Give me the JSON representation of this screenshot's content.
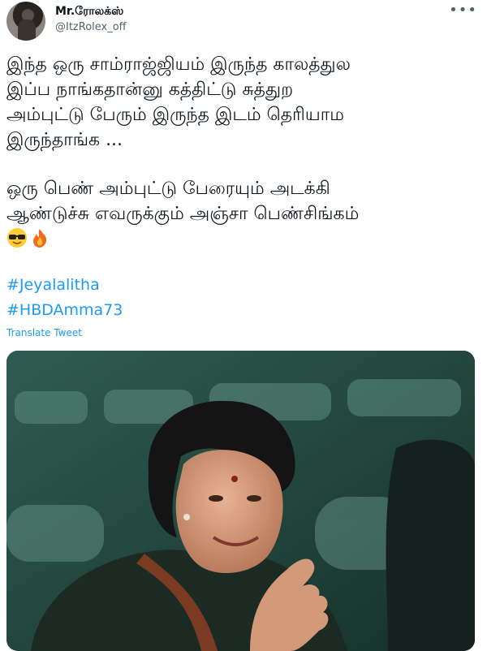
{
  "user": {
    "display_name": "Mr.ரோலக்ஸ்",
    "handle": "@ItzRolex_off"
  },
  "tweet": {
    "paragraph_1": "இந்த ஒரு சாம்ராஜ்ஜியம் இருந்த காலத்துல\nஇப்ப நாங்கதான்னு கத்திட்டு சுத்துற\nஅம்புட்டு பேரும் இருந்த இடம் தெரியாம\nஇருந்தாங்க ...",
    "paragraph_2": "ஒரு பெண் அம்புட்டு பேரையும் அடக்கி\nஆண்டுச்சு எவருக்கும் அஞ்சா பெண்சிங்கம்",
    "emojis": [
      "sunglasses-face",
      "fire"
    ],
    "hashtags": [
      "#Jeyalalitha",
      "#HBDAmma73"
    ],
    "translate_label": "Translate Tweet"
  },
  "media": {
    "icon": "photo-of-woman-waving"
  },
  "colors": {
    "link": "#1d9bf0",
    "text": "#0f1419",
    "secondary": "#536471",
    "photo_background": "#1d3a33"
  }
}
